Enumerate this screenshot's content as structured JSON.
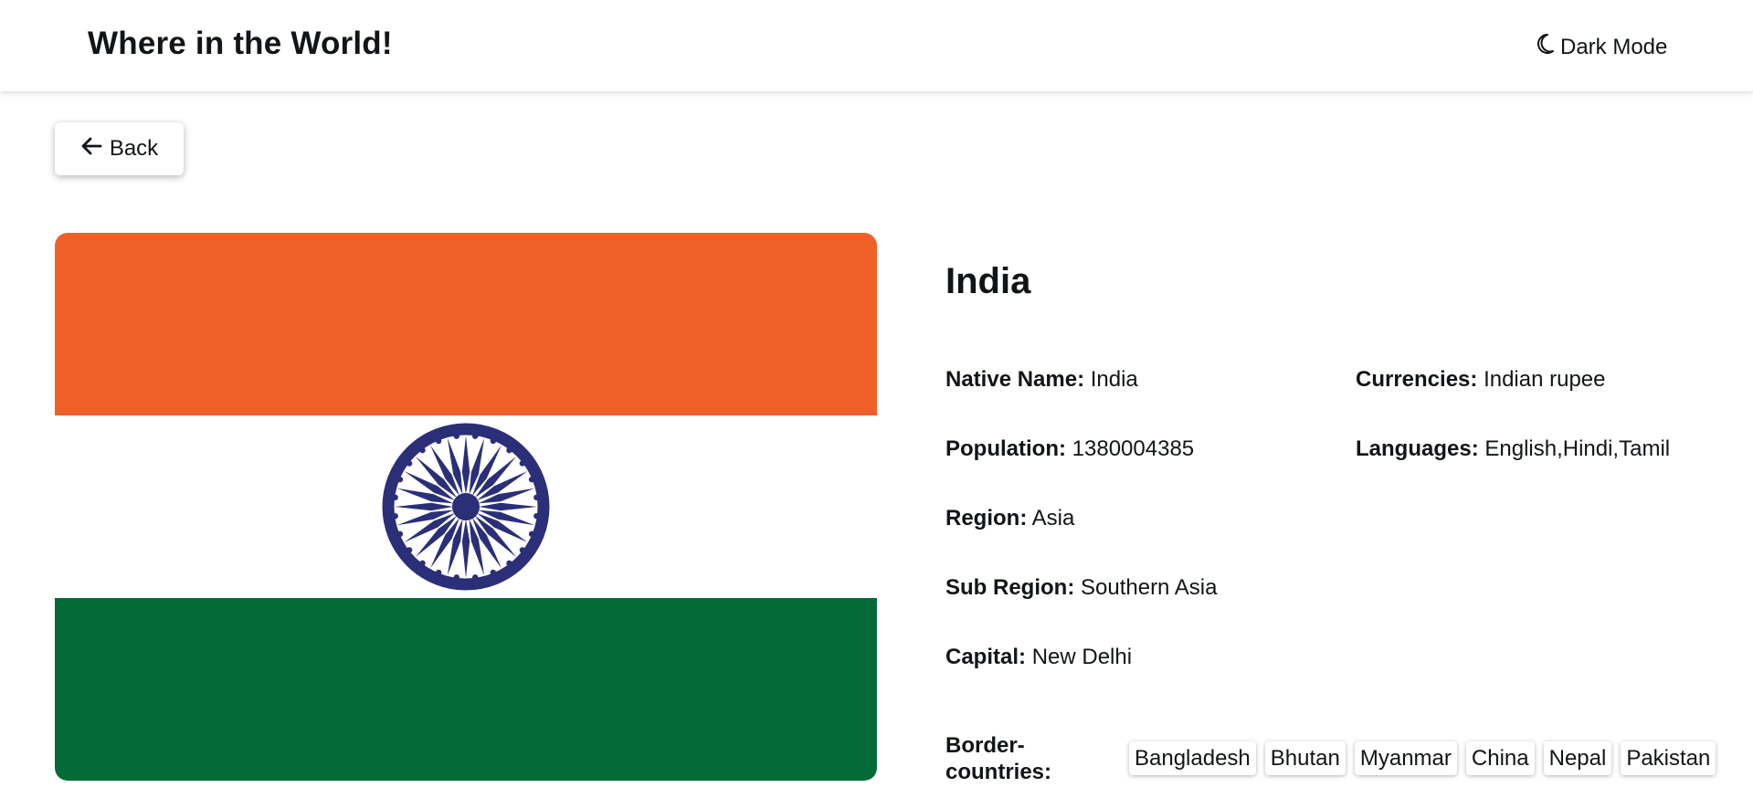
{
  "header": {
    "title": "Where in the World!",
    "dark_mode_label": "Dark Mode",
    "dark_mode_icon": "moon-icon"
  },
  "back_button": {
    "label": "Back",
    "icon": "arrow-left-icon"
  },
  "flag": {
    "alt": "India flag",
    "colors": {
      "top": "#f15f29",
      "middle": "#ffffff",
      "bottom": "#046a38",
      "wheel": "#2b2f78"
    }
  },
  "country": {
    "name": "India",
    "details_left": [
      {
        "label": "Native Name:",
        "value": "India"
      },
      {
        "label": "Population:",
        "value": "1380004385"
      },
      {
        "label": "Region:",
        "value": "Asia"
      },
      {
        "label": "Sub Region:",
        "value": "Southern Asia"
      },
      {
        "label": "Capital:",
        "value": "New Delhi"
      }
    ],
    "details_right": [
      {
        "label": "Currencies:",
        "value": "Indian rupee"
      },
      {
        "label": "Languages:",
        "value": "English,Hindi,Tamil"
      }
    ],
    "border_label": "Border-countries:",
    "border_countries": [
      "Bangladesh",
      "Bhutan",
      "Myanmar",
      "China",
      "Nepal",
      "Pakistan"
    ]
  }
}
